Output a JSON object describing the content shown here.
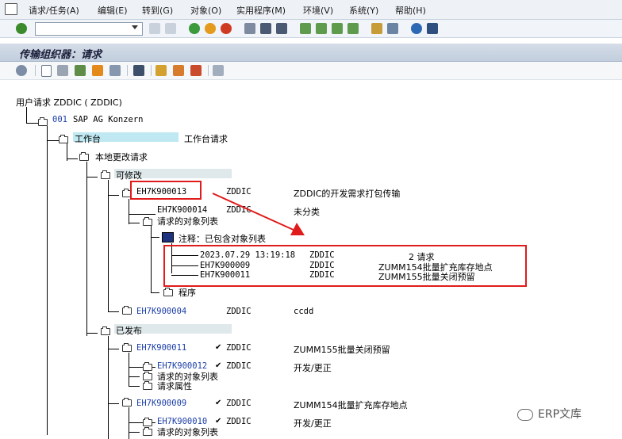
{
  "menu": [
    {
      "label": "请求/任务(A)"
    },
    {
      "label": "编辑(E)"
    },
    {
      "label": "转到(G)"
    },
    {
      "label": "对象(O)"
    },
    {
      "label": "实用程序(M)"
    },
    {
      "label": "环境(V)"
    },
    {
      "label": "系统(Y)"
    },
    {
      "label": "帮助(H)"
    }
  ],
  "window": {
    "title": "传输组织器：请求"
  },
  "tree": {
    "root": "用户请求 ZDDIC ( ZDDIC)",
    "company_code": "001",
    "company_name": "SAP AG Konzern",
    "workbench": "工作台",
    "workbench_desc": "工作台请求",
    "local_change": "本地更改请求",
    "modifiable": "可修改",
    "req1": {
      "id": "EH7K900013",
      "owner": "ZDDIC",
      "desc": "ZDDIC的开发需求打包传输"
    },
    "task1": {
      "id": "EH7K900014",
      "owner": "ZDDIC",
      "desc": "未分类"
    },
    "objlist": "请求的对象列表",
    "comment": "注释：已包含对象列表",
    "log": [
      {
        "a": "2023.07.29 13:19:18",
        "b": "ZDDIC",
        "c": "2 请求"
      },
      {
        "a": "EH7K900009",
        "b": "ZDDIC",
        "c": "ZUMM154批量扩充库存地点"
      },
      {
        "a": "EH7K900011",
        "b": "ZDDIC",
        "c": "ZUMM155批量关闭预留"
      }
    ],
    "program": "程序",
    "req2": {
      "id": "EH7K900004",
      "owner": "ZDDIC",
      "desc": "ccdd"
    },
    "released": "已发布",
    "req3": {
      "id": "EH7K900011",
      "owner": "ZDDIC",
      "desc": "ZUMM155批量关闭预留"
    },
    "task3": {
      "id": "EH7K900012",
      "owner": "ZDDIC",
      "desc": "开发/更正"
    },
    "objlist3": "请求的对象列表",
    "attr3": "请求属性",
    "req4": {
      "id": "EH7K900009",
      "owner": "ZDDIC",
      "desc": "ZUMM154批量扩充库存地点"
    },
    "task4": {
      "id": "EH7K900010",
      "owner": "ZDDIC",
      "desc": "开发/更正"
    },
    "objlist4": "请求的对象列表"
  },
  "watermark": "ERP文库",
  "colors": {
    "highlight_blue": "#bfe8f2",
    "highlight_gray": "#dfe9ec",
    "annotation_red": "#e01b1b"
  }
}
